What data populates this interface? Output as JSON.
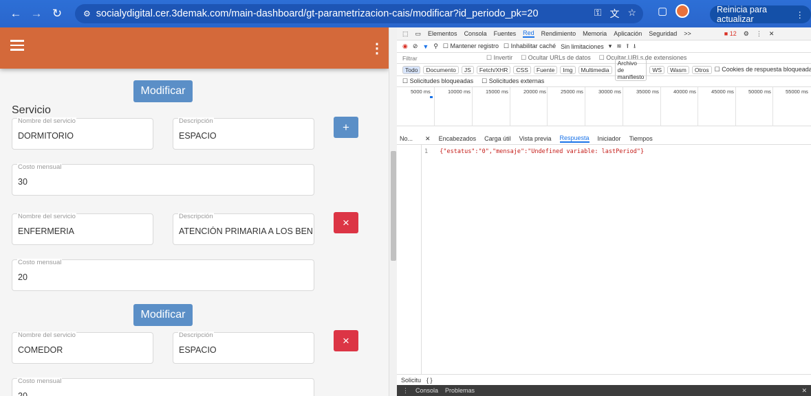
{
  "browser": {
    "url": "socialydigital.cer.3demak.com/main-dashboard/gt-parametrizacion-cais/modificar?id_periodo_pk=20",
    "update_label": "Reinicia para actualizar"
  },
  "form": {
    "modify_label": "Modificar",
    "section_title": "Servicio",
    "services": [
      {
        "name_label": "Nombre del servicio",
        "name": "DORMITORIO",
        "desc_label": "Descripción",
        "desc": "ESPACIO",
        "cost_label": "Costo mensual",
        "cost": "30",
        "action": "+"
      },
      {
        "name_label": "Nombre del servicio",
        "name": "ENFERMERIA",
        "desc_label": "Descripción",
        "desc": "ATENCIÓN PRIMARIA A LOS BENEFICI",
        "cost_label": "Costo mensual",
        "cost": "20",
        "action": "×"
      },
      {
        "name_label": "Nombre del servicio",
        "name": "COMEDOR",
        "desc_label": "Descripción",
        "desc": "ESPACIO",
        "cost_label": "Costo mensual",
        "cost": "20",
        "action": "×"
      }
    ]
  },
  "devtools": {
    "tabs": [
      "Elementos",
      "Consola",
      "Fuentes",
      "Red",
      "Rendimiento",
      "Memoria",
      "Aplicación",
      "Seguridad",
      ">>"
    ],
    "active_tab": "Red",
    "badge": "12",
    "toolbar": [
      "Mantener registro",
      "Inhabilitar caché",
      "Sin limitaciones"
    ],
    "filter_placeholder": "Filtrar",
    "filter_options": [
      "Invertir",
      "Ocultar URLs de datos",
      "Ocultar URLs de extensiones"
    ],
    "types": [
      "Todo",
      "Documento",
      "JS",
      "Fetch/XHR",
      "CSS",
      "Fuente",
      "Img",
      "Multimedia",
      "Archivo de manifiesto",
      "WS",
      "Wasm",
      "Otros"
    ],
    "blocked_cookies": "Cookies de respuesta bloqueadas",
    "blocked": [
      "Solicitudes bloqueadas",
      "Solicitudes externas"
    ],
    "timeline_ticks": [
      "5000 ms",
      "10000 ms",
      "15000 ms",
      "20000 ms",
      "25000 ms",
      "30000 ms",
      "35000 ms",
      "40000 ms",
      "45000 ms",
      "50000 ms",
      "55000 ms"
    ],
    "list_header": "No...",
    "detail_tabs": [
      "Encabezados",
      "Carga útil",
      "Vista previa",
      "Respuesta",
      "Iniciador",
      "Tiempos"
    ],
    "active_detail": "Respuesta",
    "response_line": "1",
    "response_text": "{\"estatus\":\"0\",\"mensaje\":\"Undefined variable: lastPeriod\"}",
    "bottom_label": "Solicitu",
    "console_tabs": [
      "Consola",
      "Problemas"
    ]
  }
}
